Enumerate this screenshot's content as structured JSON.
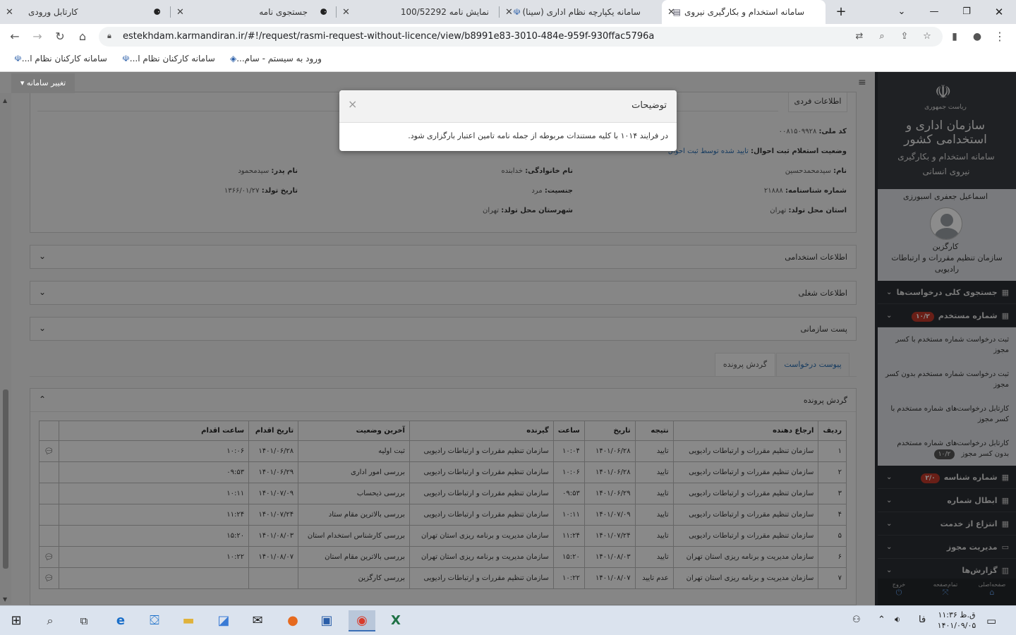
{
  "browser": {
    "tabs": [
      {
        "title": "کارتابل ورودی",
        "icon": "sina-icon",
        "active": false
      },
      {
        "title": "جستجوی نامه",
        "icon": "sina-icon",
        "active": false
      },
      {
        "title": "نمایش نامه 100/52292",
        "icon": "sina-icon",
        "active": false
      },
      {
        "title": "سامانه یکپارچه نظام اداری (سینا)",
        "icon": "iran-emblem-icon",
        "active": false
      },
      {
        "title": "سامانه استخدام و بکارگیری نیروی ا",
        "icon": "document-icon",
        "active": true
      }
    ],
    "new_tab": "+",
    "url": "estekhdam.karmandiran.ir/#!/request/rasmi-request-without-licence/view/b8991e83-3010-484e-959f-930ffac5796a",
    "bookmarks": [
      {
        "label": "ورود به سیستم - سام...",
        "icon": "bookmark-icon"
      },
      {
        "label": "سامانه کارکنان نظام ا...",
        "icon": "iran-emblem-icon"
      },
      {
        "label": "سامانه کارکنان نظام ا...",
        "icon": "iran-emblem-icon"
      }
    ]
  },
  "app": {
    "switch_system": "تغییر سامانه",
    "personal_panel": {
      "title": "اطلاعات فردی",
      "fields": {
        "national_code_label": "کد ملی:",
        "national_code": "۰۰۸۱۵۰۹۹۲۸",
        "registry_status_label": "وضعیت استعلام ثبت احوال:",
        "registry_status": "تایید شده توسط ثبت احوال",
        "first_name_label": "نام:",
        "first_name": "سیدمحمدحسین",
        "last_name_label": "نام خانوادگی:",
        "last_name": "خدابنده",
        "father_name_label": "نام پدر:",
        "father_name": "سیدمحمود",
        "id_number_label": "شماره شناسنامه:",
        "id_number": "۲۱۸۸۸",
        "gender_label": "جنسیت:",
        "gender": "مرد",
        "birth_date_label": "تاریخ تولد:",
        "birth_date": "۱۳۶۶/۰۱/۲۷",
        "birth_province_label": "استان محل تولد:",
        "birth_province": "تهران",
        "birth_city_label": "شهرستان محل تولد:",
        "birth_city": "تهران"
      }
    },
    "sections": [
      "اطلاعات استخدامی",
      "اطلاعات شغلی",
      "پست سازمانی"
    ],
    "tabs": [
      "پیوست درخواست",
      "گردش پرونده"
    ],
    "flow_panel_title": "گردش پرونده",
    "table": {
      "headers": [
        "ردیف",
        "ارجاع دهنده",
        "نتیجه",
        "تاریخ",
        "ساعت",
        "گیرنده",
        "آخرین وضعیت",
        "تاریخ اقدام",
        "ساعت اقدام"
      ],
      "rows": [
        [
          "۱",
          "سازمان تنظیم مقررات و ارتباطات رادیویی",
          "تایید",
          "۱۴۰۱/۰۶/۲۸",
          "۱۰:۰۴",
          "سازمان تنظیم مقررات و ارتباطات رادیویی",
          "ثبت اولیه",
          "۱۴۰۱/۰۶/۲۸",
          "۱۰:۰۶",
          true
        ],
        [
          "۲",
          "سازمان تنظیم مقررات و ارتباطات رادیویی",
          "تایید",
          "۱۴۰۱/۰۶/۲۸",
          "۱۰:۰۶",
          "سازمان تنظیم مقررات و ارتباطات رادیویی",
          "بررسی امور اداری",
          "۱۴۰۱/۰۶/۲۹",
          "۰۹:۵۳",
          false
        ],
        [
          "۳",
          "سازمان تنظیم مقررات و ارتباطات رادیویی",
          "تایید",
          "۱۴۰۱/۰۶/۲۹",
          "۰۹:۵۳",
          "سازمان تنظیم مقررات و ارتباطات رادیویی",
          "بررسی ذیحساب",
          "۱۴۰۱/۰۷/۰۹",
          "۱۰:۱۱",
          false
        ],
        [
          "۴",
          "سازمان تنظیم مقررات و ارتباطات رادیویی",
          "تایید",
          "۱۴۰۱/۰۷/۰۹",
          "۱۰:۱۱",
          "سازمان تنظیم مقررات و ارتباطات رادیویی",
          "بررسی بالاترین مقام ستاد",
          "۱۴۰۱/۰۷/۲۴",
          "۱۱:۲۴",
          false
        ],
        [
          "۵",
          "سازمان تنظیم مقررات و ارتباطات رادیویی",
          "تایید",
          "۱۴۰۱/۰۷/۲۴",
          "۱۱:۲۴",
          "سازمان مدیریت و برنامه ریزی استان تهران",
          "بررسی کارشناس استخدام استان",
          "۱۴۰۱/۰۸/۰۳",
          "۱۵:۲۰",
          false
        ],
        [
          "۶",
          "سازمان مدیریت و برنامه ریزی استان تهران",
          "تایید",
          "۱۴۰۱/۰۸/۰۳",
          "۱۵:۲۰",
          "سازمان مدیریت و برنامه ریزی استان تهران",
          "بررسی بالاترین مقام استان",
          "۱۴۰۱/۰۸/۰۷",
          "۱۰:۲۲",
          true
        ],
        [
          "۷",
          "سازمان مدیریت و برنامه ریزی استان تهران",
          "عدم تایید",
          "۱۴۰۱/۰۸/۰۷",
          "۱۰:۲۲",
          "سازمان تنظیم مقررات و ارتباطات رادیویی",
          "بررسی کارگزین",
          "",
          "",
          true
        ]
      ]
    },
    "modal": {
      "title": "توضیحات",
      "body": "در فرایند ۱۰۱۴ با کلیه مستندات مربوطه از جمله نامه تامین اعتبار بارگزاری شود."
    }
  },
  "sidebar": {
    "org_line1": "ریاست جمهوری",
    "org_line2": "سازمان اداری و استخدامی کشور",
    "system_name": "سامانه استخدام و بکارگیری نیروی انسانی",
    "user_name": "اسماعیل جعفری اسبورزی",
    "user_role": "کارگزین",
    "user_org": "سازمان تنظیم مقررات و ارتباطات رادیویی",
    "menu": [
      {
        "label": "جستجوی کلی درخواست‌ها",
        "badge": ""
      },
      {
        "label": "شماره مستخدم",
        "badge": "۱۰/۲"
      },
      {
        "label": "شماره شناسه",
        "badge": "۲/۰"
      },
      {
        "label": "ابطال شماره",
        "badge": ""
      },
      {
        "label": "انتزاع از خدمت",
        "badge": ""
      },
      {
        "label": "مدیریت مجوز",
        "badge": ""
      },
      {
        "label": "گزارش‌ها",
        "badge": ""
      }
    ],
    "submenu": [
      {
        "label": "ثبت درخواست شماره مستخدم با کسر مجوز",
        "badge": ""
      },
      {
        "label": "ثبت درخواست شماره مستخدم بدون کسر مجوز",
        "badge": ""
      },
      {
        "label": "کارتابل درخواست‌های شماره مستخدم با کسر مجوز",
        "badge": ""
      },
      {
        "label": "کارتابل درخواست‌های شماره مستخدم بدون کسر مجوز",
        "badge": "۱۰/۲"
      }
    ],
    "footer": [
      "صفحه‌اصلی",
      "تمام‌صفحه",
      "خروج"
    ]
  },
  "taskbar": {
    "time": "ق.ظ ۱۱:۳۶",
    "date": "۱۴۰۱/۰۹/۰۵",
    "lang": "فا"
  },
  "colors": {
    "sidebar_bg": "#2b2e33",
    "link": "#2a6db0",
    "badge": "#c0392b"
  }
}
